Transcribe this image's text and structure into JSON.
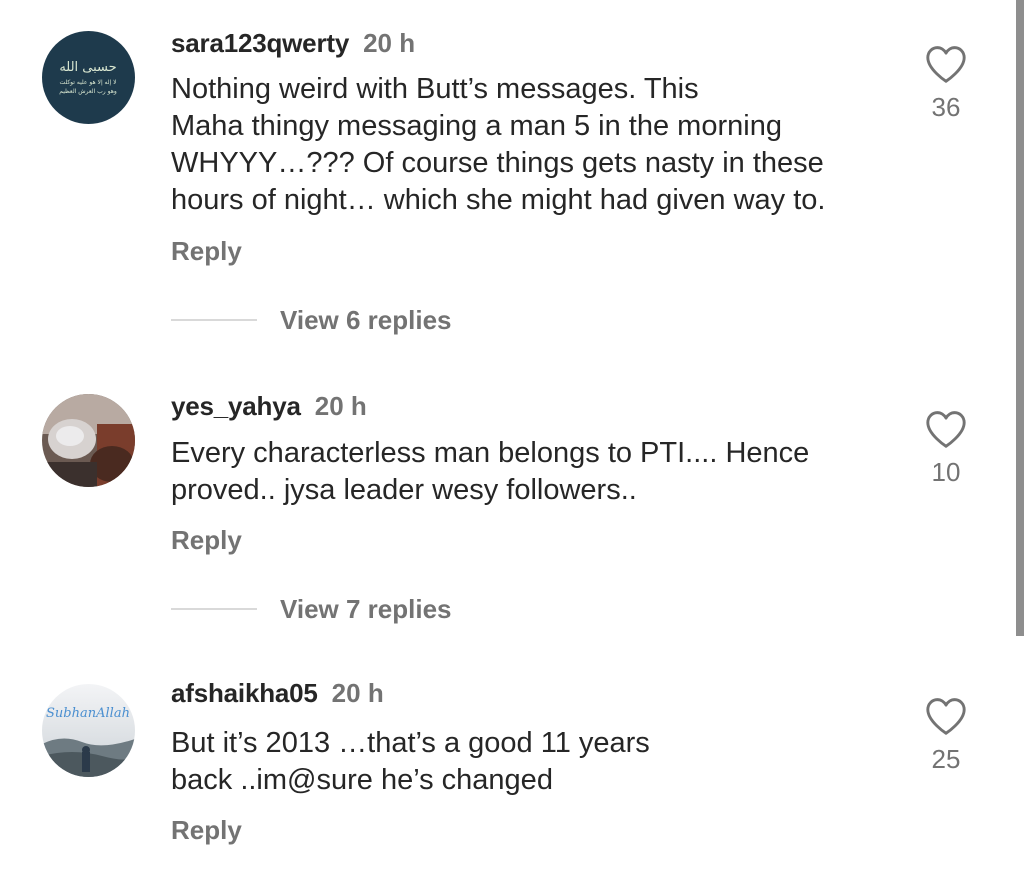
{
  "comments": [
    {
      "username": "sara123qwerty",
      "time": "20 h",
      "avatar": "arabic-calligraphy-avatar",
      "avatar_text": [
        "حسبی الله",
        "لا إله إلا هو عليه توكلت",
        "وهو رب العرش العظيم"
      ],
      "text": "Nothing weird with Butt’s messages. This\nMaha thingy messaging a man 5 in the morning\nWHYYY…??? Of course things gets nasty in these\nhours of night… which she might had given way to.",
      "reply_label": "Reply",
      "likes": "36",
      "view_replies": "View 6 replies"
    },
    {
      "username": "yes_yahya",
      "time": "20 h",
      "avatar": "photo-avatar",
      "text": "Every characterless man belongs to PTI.... Hence\nproved.. jysa leader wesy followers..",
      "reply_label": "Reply",
      "likes": "10",
      "view_replies": "View 7 replies"
    },
    {
      "username": "afshaikha05",
      "time": "20 h",
      "avatar": "landscape-avatar",
      "avatar_text": "SubhanAllah",
      "text": "But it’s 2013 …that’s a good 11 years\nback ..im@sure he’s changed",
      "reply_label": "Reply",
      "likes": "25"
    }
  ],
  "colors": {
    "text": "#262626",
    "secondary": "#737373",
    "divider": "#d9d9d9",
    "avatar1_bg": "#1e3a4c"
  },
  "icons": {
    "like": "heart-outline-icon"
  }
}
